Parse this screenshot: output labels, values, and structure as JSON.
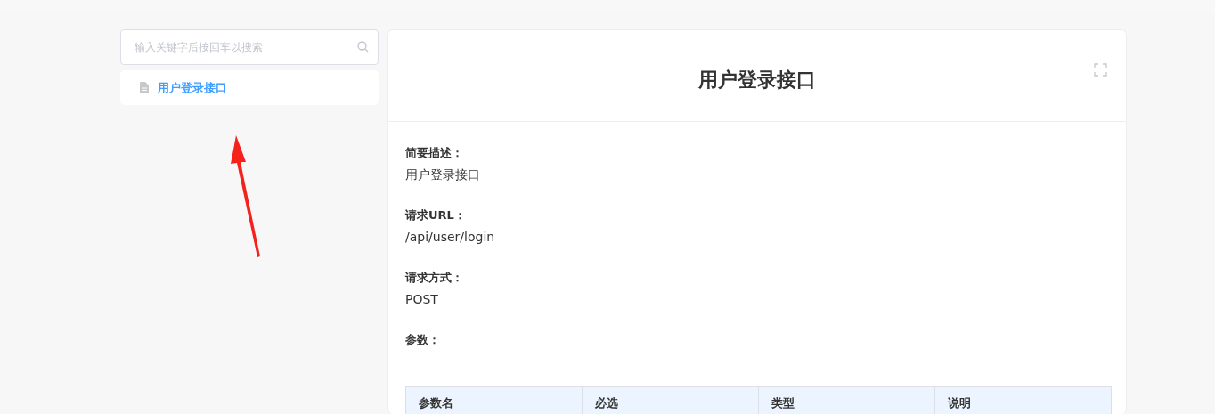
{
  "sidebar": {
    "search": {
      "placeholder": "输入关键字后按回车以搜索"
    },
    "items": [
      {
        "label": "用户登录接口",
        "selected": true
      }
    ]
  },
  "document": {
    "title": "用户登录接口",
    "sections": [
      {
        "label": "简要描述：",
        "value": "用户登录接口"
      },
      {
        "label": "请求URL：",
        "value": "/api/user/login"
      },
      {
        "label": "请求方式：",
        "value": "POST"
      },
      {
        "label": "参数："
      }
    ],
    "table": {
      "columns": [
        "参数名",
        "必选",
        "类型",
        "说明"
      ]
    }
  }
}
